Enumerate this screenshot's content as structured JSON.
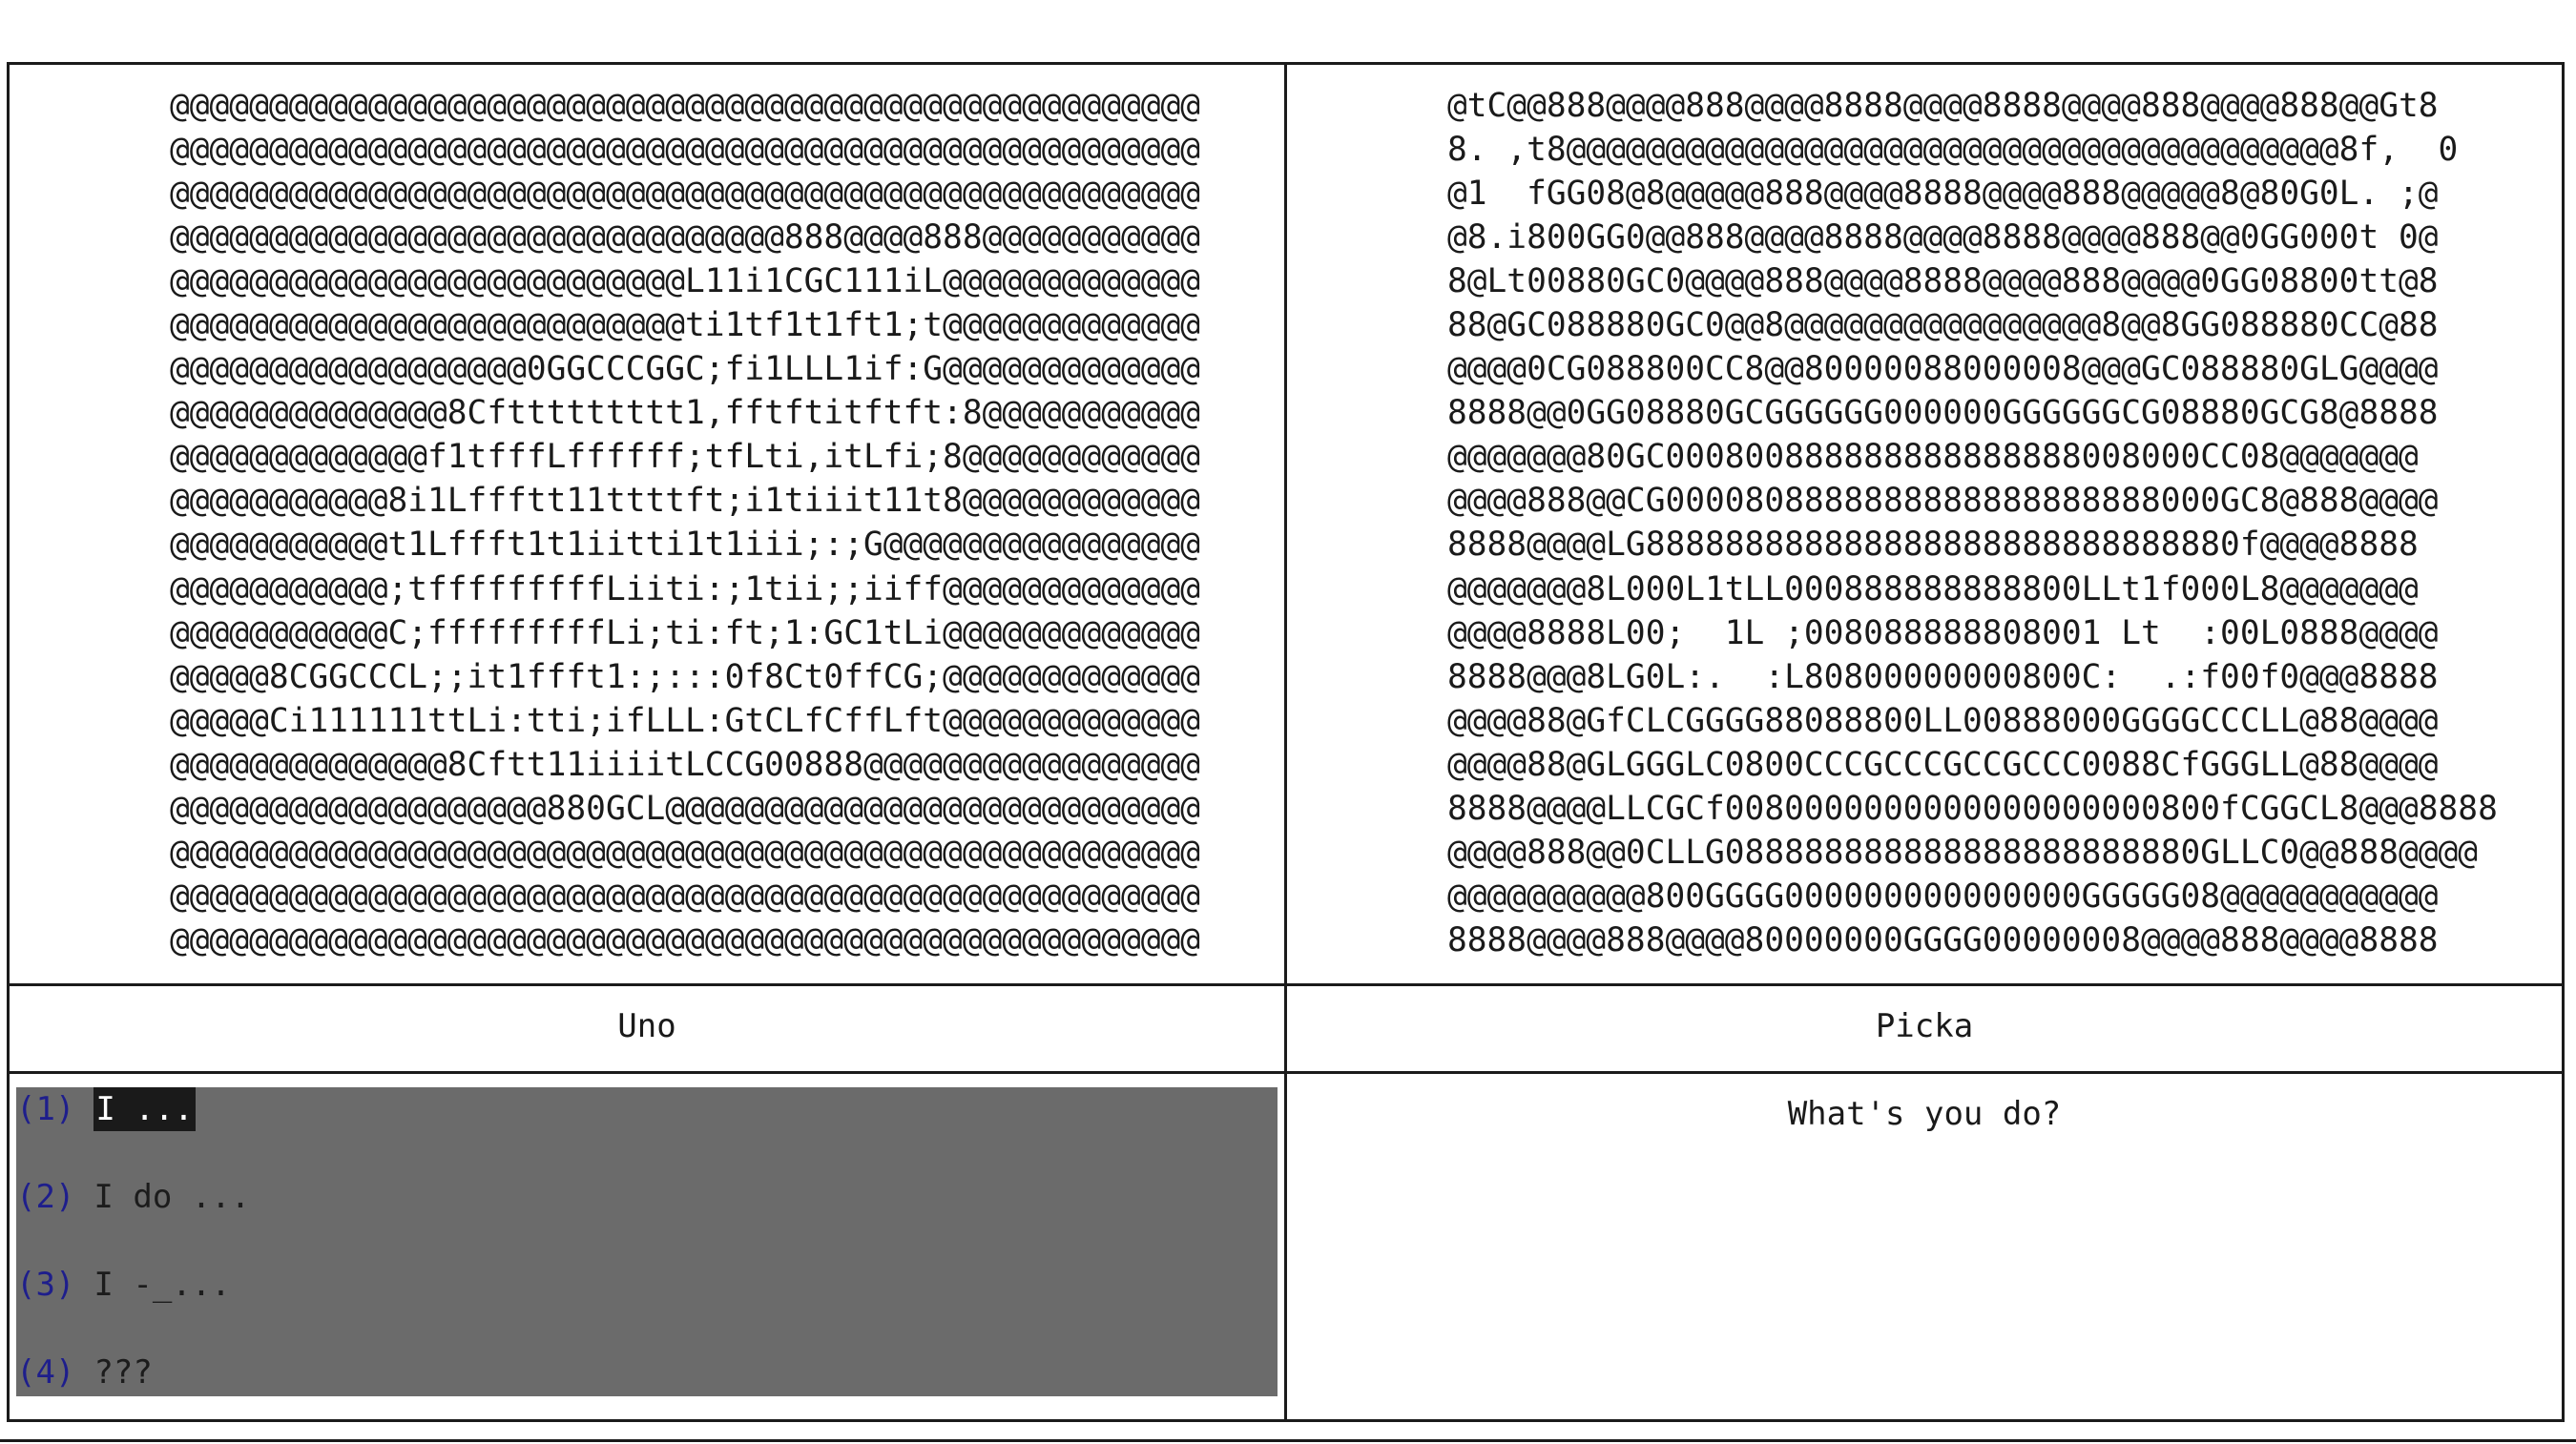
{
  "art_left": "@@@@@@@@@@@@@@@@@@@@@@@@@@@@@@@@@@@@@@@@@@@@@@@@@@@@\n@@@@@@@@@@@@@@@@@@@@@@@@@@@@@@@@@@@@@@@@@@@@@@@@@@@@\n@@@@@@@@@@@@@@@@@@@@@@@@@@@@@@@@@@@@@@@@@@@@@@@@@@@@\n@@@@@@@@@@@@@@@@@@@@@@@@@@@@@@@888@@@@888@@@@@@@@@@@\n@@@@@@@@@@@@@@@@@@@@@@@@@@L11i1CGC111iL@@@@@@@@@@@@@\n@@@@@@@@@@@@@@@@@@@@@@@@@@ti1tf1t1ft1;t@@@@@@@@@@@@@\n@@@@@@@@@@@@@@@@@@0GGCCCGGC;fi1LLL1if:G@@@@@@@@@@@@@\n@@@@@@@@@@@@@@8Cfttttttttt1,fftftitftft:8@@@@@@@@@@@\n@@@@@@@@@@@@@f1tfffLffffff;tfLti,itLfi;8@@@@@@@@@@@@\n@@@@@@@@@@@8i1Lffftt11ttttft;i1tiiit11t8@@@@@@@@@@@@\n@@@@@@@@@@@t1Lffft1t1iitti1t1iii;:;G@@@@@@@@@@@@@@@@\n@@@@@@@@@@@;tfffffffffLiiti:;1tii;;iiff@@@@@@@@@@@@@\n@@@@@@@@@@@C;fffffffffLi;ti:ft;1:GC1tLi@@@@@@@@@@@@@\n@@@@@8CGGCCCL;;it1ffft1:;:::0f8Ct0ffCG;@@@@@@@@@@@@@\n@@@@@Ci111111ttLi:tti;ifLLL:GtCLfCffLft@@@@@@@@@@@@@\n@@@@@@@@@@@@@@8Cftt11iiiitLCCG00888@@@@@@@@@@@@@@@@@\n@@@@@@@@@@@@@@@@@@@880GCL@@@@@@@@@@@@@@@@@@@@@@@@@@@\n@@@@@@@@@@@@@@@@@@@@@@@@@@@@@@@@@@@@@@@@@@@@@@@@@@@@\n@@@@@@@@@@@@@@@@@@@@@@@@@@@@@@@@@@@@@@@@@@@@@@@@@@@@\n@@@@@@@@@@@@@@@@@@@@@@@@@@@@@@@@@@@@@@@@@@@@@@@@@@@@",
  "art_right": "@tC@@888@@@@888@@@@8888@@@@8888@@@@888@@@@888@@Gt8\n8. ,t8@@@@@@@@@@@@@@@@@@@@@@@@@@@@@@@@@@@@@@@8f,  0\n@1  fGG08@8@@@@@888@@@@8888@@@@888@@@@@8@80G0L. ;@\n@8.i800GG0@@888@@@@8888@@@@8888@@@@888@@0GG000t 0@\n8@Lt00880GC0@@@@888@@@@8888@@@@888@@@@0GG08800tt@8\n88@GC088880GC0@@8@@@@@@@@@@@@@@@@8@@8GG088880CC@88\n@@@@0CG088800CC8@@80000088000008@@@GC088880GLG@@@@\n8888@@0GG08880GCGGGGGG000000GGGGGGCG08880GCG8@8888\n@@@@@@@80GC000800888888888888888008000CC08@@@@@@@\n@@@@888@@CG0000808888888888888888888000GC8@888@@@@\n8888@@@@LG888888888888888888888888888880f@@@@8888\n@@@@@@@8L000L1tLL000888888888800LLt1f000L8@@@@@@@\n@@@@8888L00;  1L ;008088888808001 Lt  :00L0888@@@@\n8888@@@8LG0L:.  :L80800000000800C:  .:f00f0@@@8888\n@@@@88@GfCLCGGGG88088800LL00888000GGGGCCCLL@88@@@@\n@@@@88@GLGGGLC0800CCCGCCCGCCGCCC0088CfGGGLL@88@@@@\n8888@@@@LLCGCf0080000000000000000000800fCGGCL8@@@8888\n@@@@888@@0CLLG088888888888888888888880GLLC0@@888@@@@\n@@@@@@@@@@800GGGG000000000000000GGGGG08@@@@@@@@@@@\n8888@@@@888@@@@80000000GGGG00000008@@@@888@@@@8888",
  "labels": {
    "left": "Uno",
    "right": "Picka"
  },
  "prompt": "What's you do?",
  "options": [
    {
      "num": "(1)",
      "text": "I ..."
    },
    {
      "num": "(2)",
      "text": "I do ..."
    },
    {
      "num": "(3)",
      "text": "I -_..."
    },
    {
      "num": "(4)",
      "text": "???"
    }
  ],
  "selected_option": 1,
  "colors": {
    "menu_bg": "#6b6b6b",
    "option_number": "#1e1e8c",
    "selected_bg": "#1a1a1a",
    "selected_text": "#ffffff"
  }
}
